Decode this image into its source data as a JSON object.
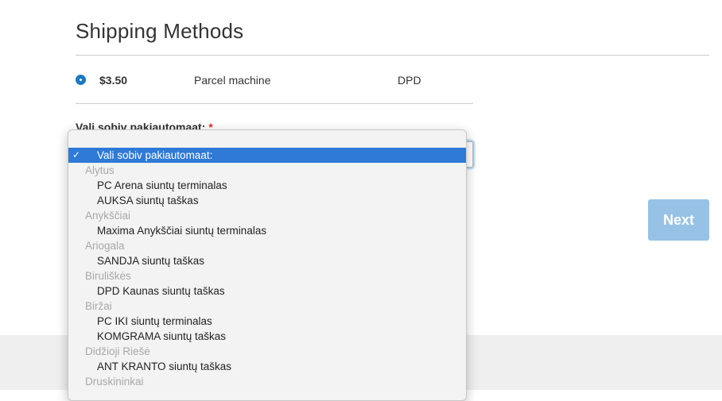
{
  "shipping": {
    "title": "Shipping Methods",
    "method": {
      "price": "$3.50",
      "name": "Parcel machine",
      "carrier": "DPD",
      "selected": true
    }
  },
  "terminal_field": {
    "label": "Vali sobiv pakiautomaat:",
    "required_mark": "*"
  },
  "actions": {
    "next_label": "Next"
  },
  "dropdown": {
    "check_glyph": "✓",
    "options": [
      {
        "label": "Vali sobiv pakiautomaat:",
        "type": "option",
        "selected": true
      },
      {
        "label": "Alytus",
        "type": "group"
      },
      {
        "label": "PC Arena siuntų terminalas",
        "type": "option"
      },
      {
        "label": "AUKSA siuntų taškas",
        "type": "option"
      },
      {
        "label": "Anykščiai",
        "type": "group"
      },
      {
        "label": "Maxima Anykščiai siuntų terminalas",
        "type": "option"
      },
      {
        "label": "Ariogala",
        "type": "group"
      },
      {
        "label": "SANDJA siuntų taškas",
        "type": "option"
      },
      {
        "label": "Biruliškės",
        "type": "group"
      },
      {
        "label": "DPD Kaunas siuntų taškas",
        "type": "option"
      },
      {
        "label": "Biržai",
        "type": "group"
      },
      {
        "label": "PC IKI siuntų terminalas",
        "type": "option"
      },
      {
        "label": "KOMGRAMA siuntų taškas",
        "type": "option"
      },
      {
        "label": "Didžioji Riešė",
        "type": "group"
      },
      {
        "label": "ANT KRANTO siuntų taškas",
        "type": "option"
      },
      {
        "label": "Druskininkai",
        "type": "group"
      }
    ]
  },
  "colors": {
    "accent": "#1979c3",
    "button_disabled": "#97c2e6",
    "selected_option": "#2e7ad6",
    "required": "#e02b27"
  }
}
